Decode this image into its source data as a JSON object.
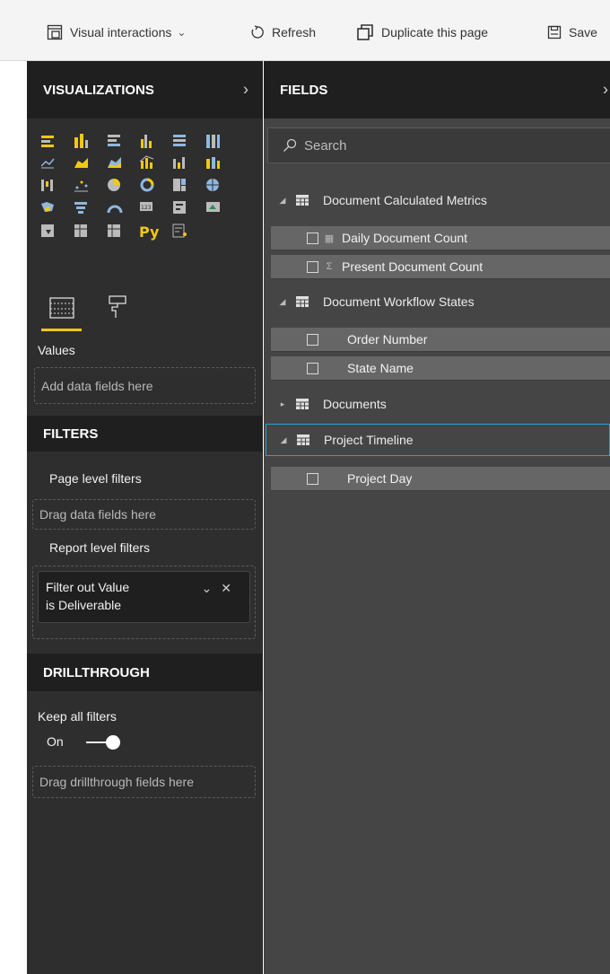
{
  "toolbar": {
    "visual_interactions": "Visual interactions",
    "refresh": "Refresh",
    "duplicate": "Duplicate this page",
    "save": "Save"
  },
  "visualizations": {
    "title": "VISUALIZATIONS",
    "values_label": "Values",
    "values_placeholder": "Add data fields here"
  },
  "filters": {
    "title": "FILTERS",
    "page_level": "Page level filters",
    "page_placeholder": "Drag data fields here",
    "report_level": "Report level filters",
    "report_filter_line1": "Filter out Value",
    "report_filter_line2": "is Deliverable"
  },
  "drillthrough": {
    "title": "DRILLTHROUGH",
    "keep_all": "Keep all filters",
    "toggle_state": "On",
    "placeholder": "Drag drillthrough fields here"
  },
  "fields": {
    "title": "FIELDS",
    "search_placeholder": "Search",
    "tables": [
      {
        "name": "Document Calculated Metrics",
        "expanded": true,
        "fields": [
          {
            "name": "Daily Document Count",
            "type": "calc-icon"
          },
          {
            "name": "Present Document Count",
            "type": "sigma-icon"
          }
        ]
      },
      {
        "name": "Document Workflow States",
        "expanded": true,
        "fields": [
          {
            "name": "Order Number"
          },
          {
            "name": "State Name"
          }
        ]
      },
      {
        "name": "Documents",
        "expanded": false,
        "fields": []
      },
      {
        "name": "Project Timeline",
        "expanded": true,
        "selected": true,
        "fields": [
          {
            "name": "Project Day"
          }
        ]
      }
    ]
  },
  "colors": {
    "accent": "#f2c811",
    "selection": "#2aa0d6",
    "pane_dark": "#2e2e2e",
    "pane_fields": "#454545"
  }
}
